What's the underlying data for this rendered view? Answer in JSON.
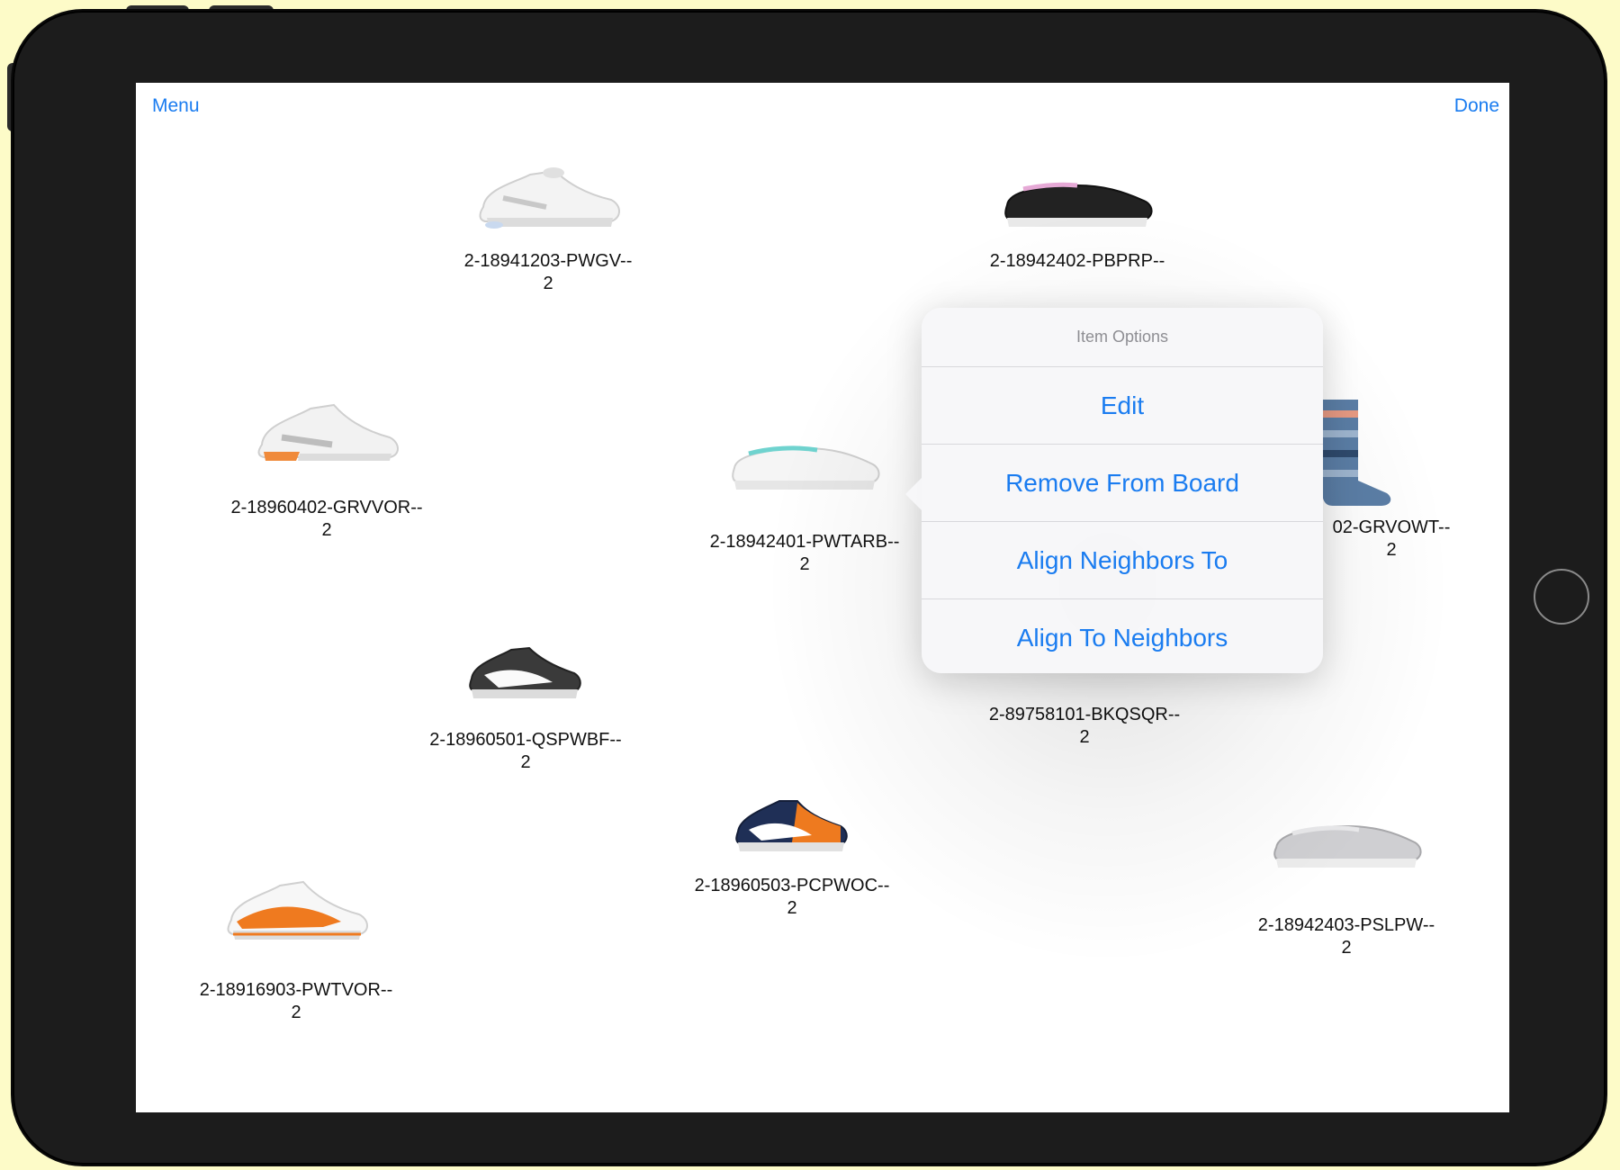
{
  "nav": {
    "menu_label": "Menu",
    "done_label": "Done"
  },
  "items": [
    {
      "code": "2-18941203-PWGV--",
      "qty": "2"
    },
    {
      "code": "2-18942402-PBPRP--",
      "qty": ""
    },
    {
      "code": "2-18960402-GRVVOR--",
      "qty": "2"
    },
    {
      "code": "2-18942401-PWTARB--",
      "qty": "2"
    },
    {
      "code": "02-GRVOWT--",
      "qty": "2"
    },
    {
      "code": "2-18960501-QSPWBF--",
      "qty": "2"
    },
    {
      "code": "2-89758101-BKQSQR--",
      "qty": "2"
    },
    {
      "code": "2-18960503-PCPWOC--",
      "qty": "2"
    },
    {
      "code": "2-18942403-PSLPW--",
      "qty": "2"
    },
    {
      "code": "2-18916903-PWTVOR--",
      "qty": "2"
    }
  ],
  "popover": {
    "title": "Item Options",
    "options": [
      {
        "label": "Edit"
      },
      {
        "label": "Remove From Board"
      },
      {
        "label": "Align Neighbors To"
      },
      {
        "label": "Align To Neighbors"
      }
    ]
  },
  "colors": {
    "accent": "#1a7cf0",
    "background": "#fdfbc8",
    "device": "#1c1c1c"
  }
}
